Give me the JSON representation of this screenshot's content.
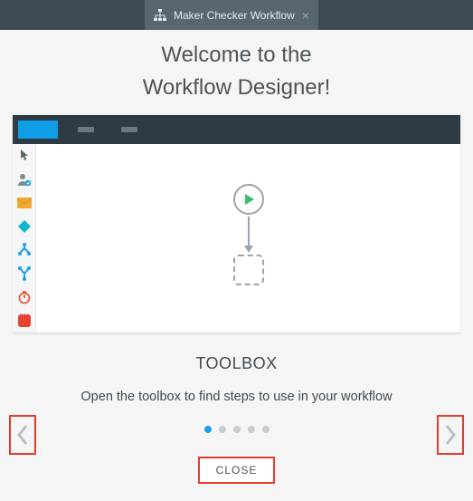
{
  "tab": {
    "label": "Maker Checker Workflow"
  },
  "welcome": {
    "line1": "Welcome to the",
    "line2": "Workflow Designer!"
  },
  "toolbox": {
    "items": [
      {
        "name": "pointer-icon"
      },
      {
        "name": "user-check-icon"
      },
      {
        "name": "mail-icon"
      },
      {
        "name": "diamond-icon"
      },
      {
        "name": "split-icon"
      },
      {
        "name": "merge-icon"
      },
      {
        "name": "timer-icon"
      },
      {
        "name": "stop-icon"
      }
    ]
  },
  "carousel": {
    "title": "TOOLBOX",
    "description": "Open the toolbox to find steps to use in your workflow",
    "dots": 5,
    "active": 0,
    "close_label": "CLOSE"
  }
}
